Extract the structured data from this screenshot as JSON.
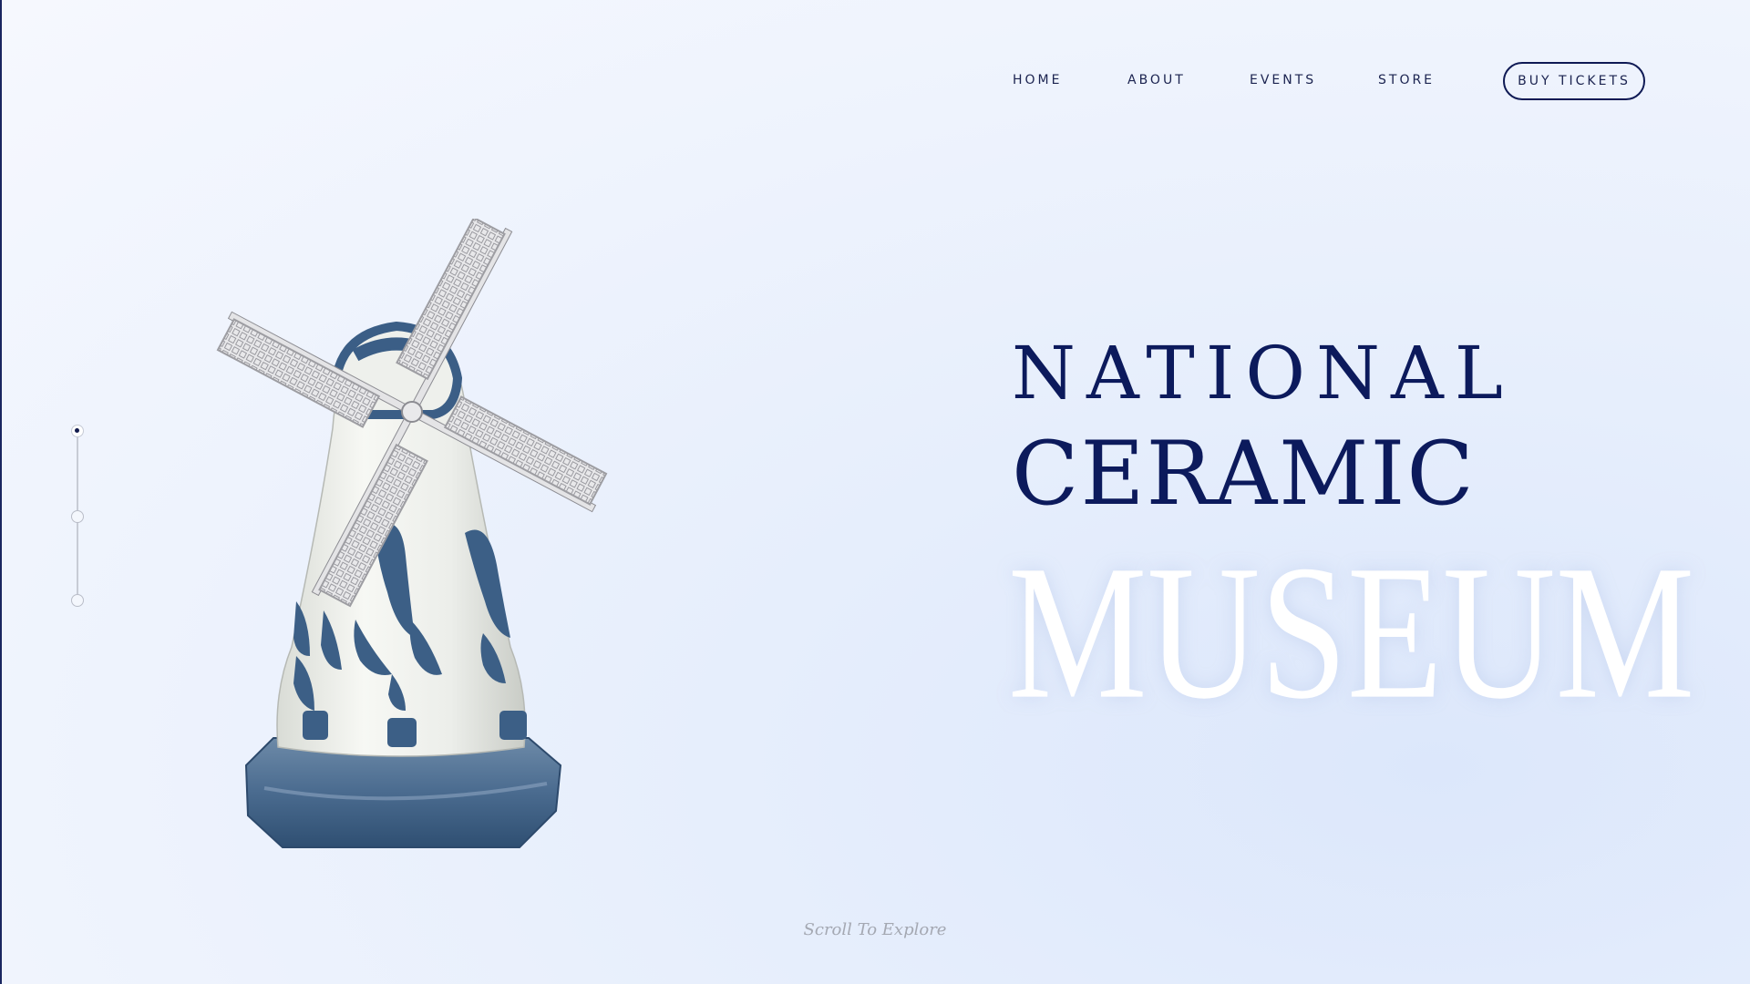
{
  "nav": {
    "home": "HOME",
    "about": "ABOUT",
    "events": "EVENTS",
    "store": "STORE",
    "tickets": "BUY TICKETS"
  },
  "hero": {
    "line1": "NATIONAL",
    "line2": "CERAMIC",
    "line3": "MUSEUM",
    "image": "delft-blue-ceramic-windmill"
  },
  "pager": {
    "count": 3,
    "active_index": 0
  },
  "scroll_hint": "Scroll To Explore",
  "colors": {
    "navy": "#0c1a5c",
    "delft_blue": "#3c5f86",
    "ceramic_white": "#eef0ec",
    "background": "#e6eefc"
  }
}
